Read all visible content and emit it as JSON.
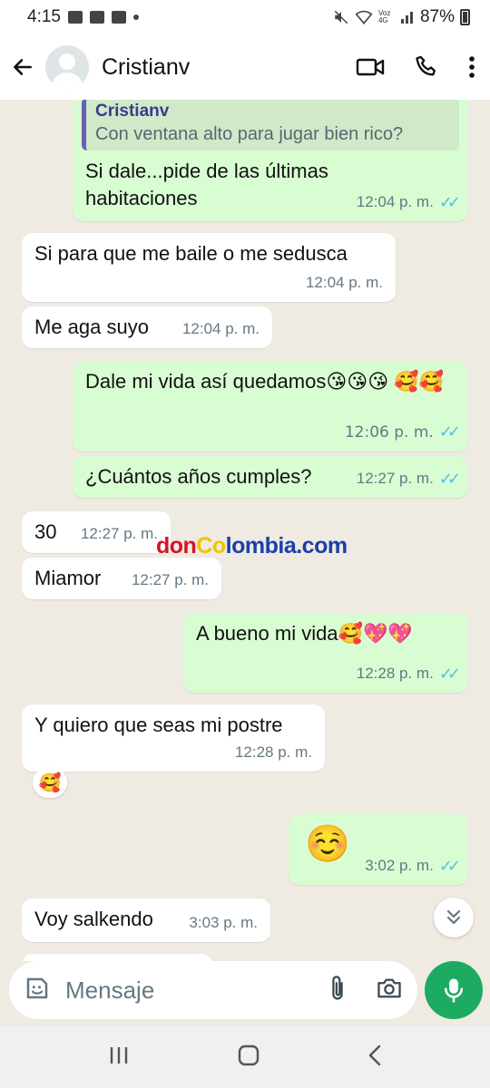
{
  "status_bar": {
    "time": "4:15",
    "battery": "87%",
    "network_label": "Voz 4G"
  },
  "header": {
    "contact_name": "Cristianv"
  },
  "messages": [
    {
      "id": "m1",
      "direction": "out",
      "quote_author": "Cristianv",
      "quote_text": "Con ventana alto para jugar bien rico?",
      "text": "Si dale...pide de las últimas habitaciones",
      "time": "12:04 p. m.",
      "read": true
    },
    {
      "id": "m2",
      "direction": "in",
      "text": "Si para que me baile o me sedusca",
      "time": "12:04 p. m."
    },
    {
      "id": "m3",
      "direction": "in",
      "text": "Me aga suyo",
      "time": "12:04 p. m."
    },
    {
      "id": "m4",
      "direction": "out",
      "text": "Dale mi vida así quedamos😘😘😘 🥰🥰",
      "time": "12:06 p. m.",
      "read": true
    },
    {
      "id": "m5",
      "direction": "out",
      "text": "¿Cuántos años cumples?",
      "time": "12:27 p. m.",
      "read": true
    },
    {
      "id": "m6",
      "direction": "in",
      "text": "30",
      "time": "12:27 p. m."
    },
    {
      "id": "m7",
      "direction": "in",
      "text": "Miamor",
      "time": "12:27 p. m."
    },
    {
      "id": "m8",
      "direction": "out",
      "text": "A bueno mi vida🥰💖💖",
      "time": "12:28 p. m.",
      "read": true
    },
    {
      "id": "m9",
      "direction": "in",
      "text": "Y quiero que seas mi postre",
      "time": "12:28 p. m.",
      "reaction": "🥰"
    },
    {
      "id": "m10",
      "direction": "out",
      "text": "☺️",
      "time": "3:02 p. m.",
      "read": true
    },
    {
      "id": "m11",
      "direction": "in",
      "text": "Voy salkendo",
      "time": "3:03 p. m."
    }
  ],
  "watermark": {
    "part_a": "don",
    "part_b": "Co",
    "part_c": "lombia.com"
  },
  "composer": {
    "placeholder": "Mensaje"
  },
  "icons": {
    "back": "arrow-left-icon",
    "video": "video-call-icon",
    "call": "phone-icon",
    "menu": "more-vertical-icon",
    "emoji": "sticker-icon",
    "attach": "paperclip-icon",
    "camera": "camera-icon",
    "mic": "microphone-icon",
    "scroll": "double-chevron-down-icon"
  },
  "colors": {
    "outgoing_bubble": "#d9fdd3",
    "incoming_bubble": "#ffffff",
    "read_ticks": "#53bdeb",
    "mic_button": "#1daa61",
    "chat_background": "#efeae2"
  }
}
